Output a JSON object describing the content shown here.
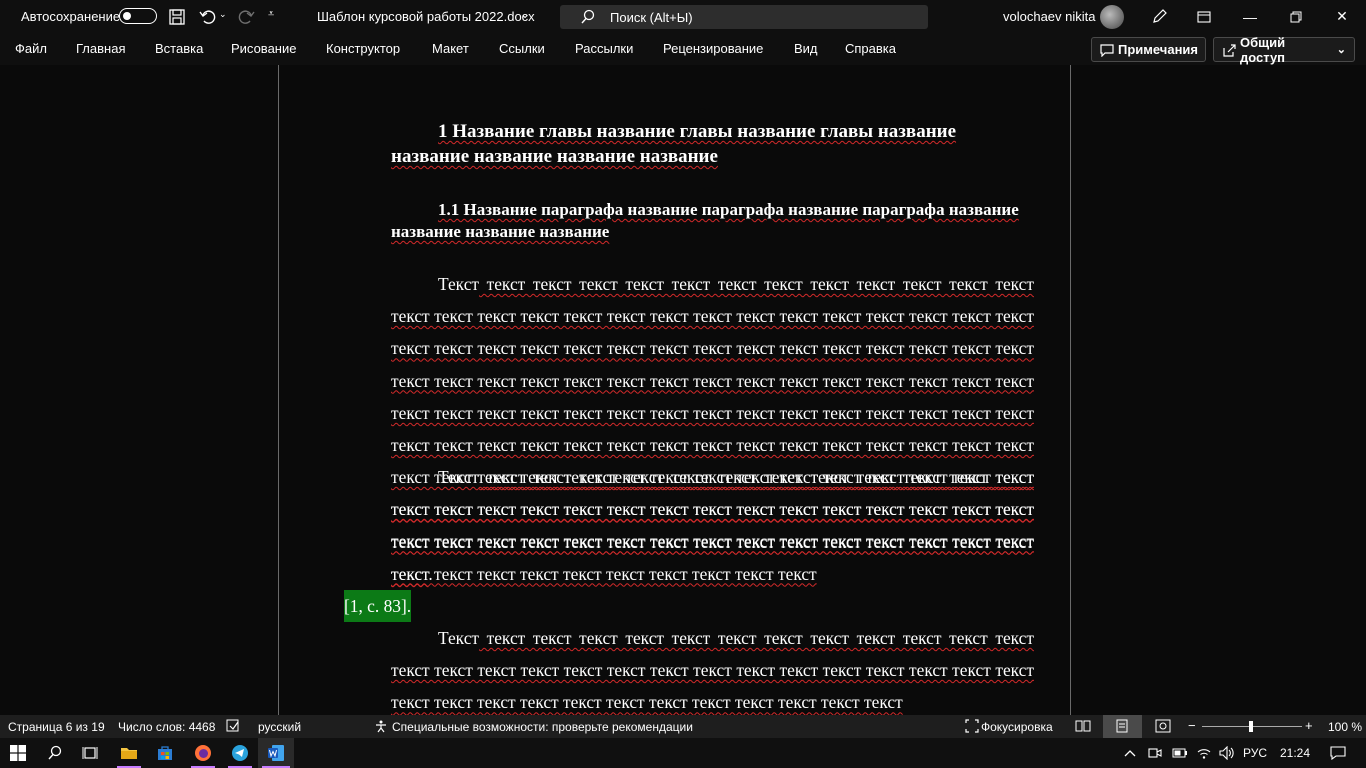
{
  "titlebar": {
    "autosave_label": "Автосохранение",
    "filename": "Шаблон курсовой работы 2022.docx",
    "search_label": "Поиск (Alt+Ы)",
    "user_name": "volochaev nikita"
  },
  "menu": {
    "items": [
      "Файл",
      "Главная",
      "Вставка",
      "Рисование",
      "Конструктор",
      "Макет",
      "Ссылки",
      "Рассылки",
      "Рецензирование",
      "Вид",
      "Справка"
    ],
    "comments_label": "Примечания",
    "share_label": "Общий доступ"
  },
  "document": {
    "heading1": "1 Название главы название главы название главы название название название название название",
    "heading2": "1.1 Название параграфа название параграфа название параграфа название название название название",
    "para1_first": "Текст",
    "para1_rest": " текст текст текст текст текст текст текст текст текст текст текст текст текст текст текст текст текст текст текст текст текст текст текст текст текст текст текст текст текст текст текст текст текст текст текст текст текст текст текст текст текст текст текст текст текст текст текст текст текст текст текст текст текст текст текст текст текст текст текст текст текст текст текст текст текст текст текст текст текст текст текст текст текст текст текст текст текст текст текст текст текст текст текст текст текст текст текст текст текст текст текст текст текст текст текст текст текст текст текст текст текст текст текст текст текст текст текст текст текст текст текст текст текст текст текст текст текст текст текст текст текст текст текст текст текст текст текст текст текст текст текст текст текст",
    "para1_end": ".",
    "para2_first": "Текст",
    "para2_rest": " текст текст текст текст текст текст текст текст текст текст текст текст текст текст текст текст текст текст текст текст текст текст текст текст текст текст текст текст текст текст текст текст текст текст текст текст текст текст текст текст текст текст текст текст текст текст текст текст текст текст текст текст",
    "citation": "[1, с. 83].",
    "para3_first": "Текст",
    "para3_rest": " текст текст текст текст текст текст текст текст текст текст текст текст текст текст текст текст текст текст текст текст текст текст текст текст текст текст текст текст текст текст текст текст текст текст текст текст текст текст текст"
  },
  "status": {
    "page": "Страница 6 из 19",
    "words": "Число слов: 4468",
    "language": "русский",
    "accessibility": "Специальные возможности: проверьте рекомендации",
    "focus": "Фокусировка",
    "zoom": "100 %"
  },
  "taskbar": {
    "language": "РУС",
    "time": "21:24"
  },
  "colors": {
    "spell_underline": "#d32a2a",
    "citation_highlight": "#0c7a16",
    "accent_underline": "#c77dff"
  }
}
